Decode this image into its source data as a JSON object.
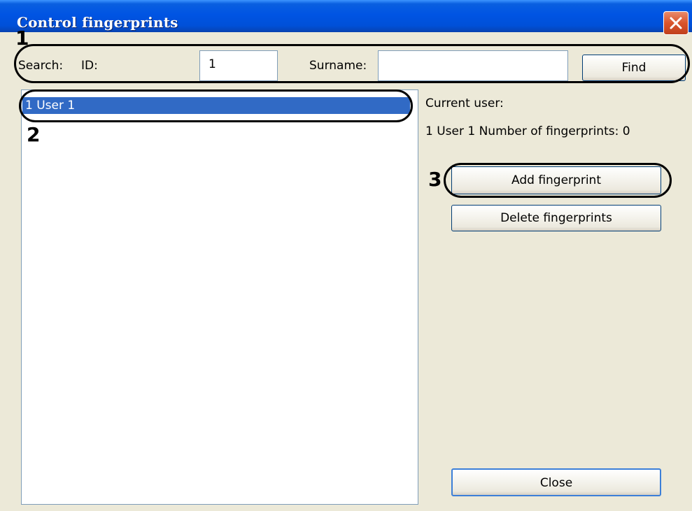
{
  "window": {
    "title": "Control fingerprints",
    "close_icon": "close-icon",
    "title_color": "#0054e3",
    "face_color": "#ece9d8"
  },
  "search": {
    "search_label": "Search:",
    "id_label": "ID:",
    "id_value": "1",
    "surname_label": "Surname:",
    "surname_value": "",
    "find_label": "Find"
  },
  "users": {
    "items": [
      {
        "label": "1 User 1",
        "selected": true
      }
    ],
    "selection_color": "#316ac5"
  },
  "details": {
    "current_user_label": "Current user:",
    "current_user_info": "1 User 1  Number of fingerprints: 0",
    "add_label": "Add fingerprint",
    "delete_label": "Delete fingerprints",
    "close_label": "Close"
  },
  "annotations": {
    "n1": "1",
    "n2": "2",
    "n3": "3"
  }
}
